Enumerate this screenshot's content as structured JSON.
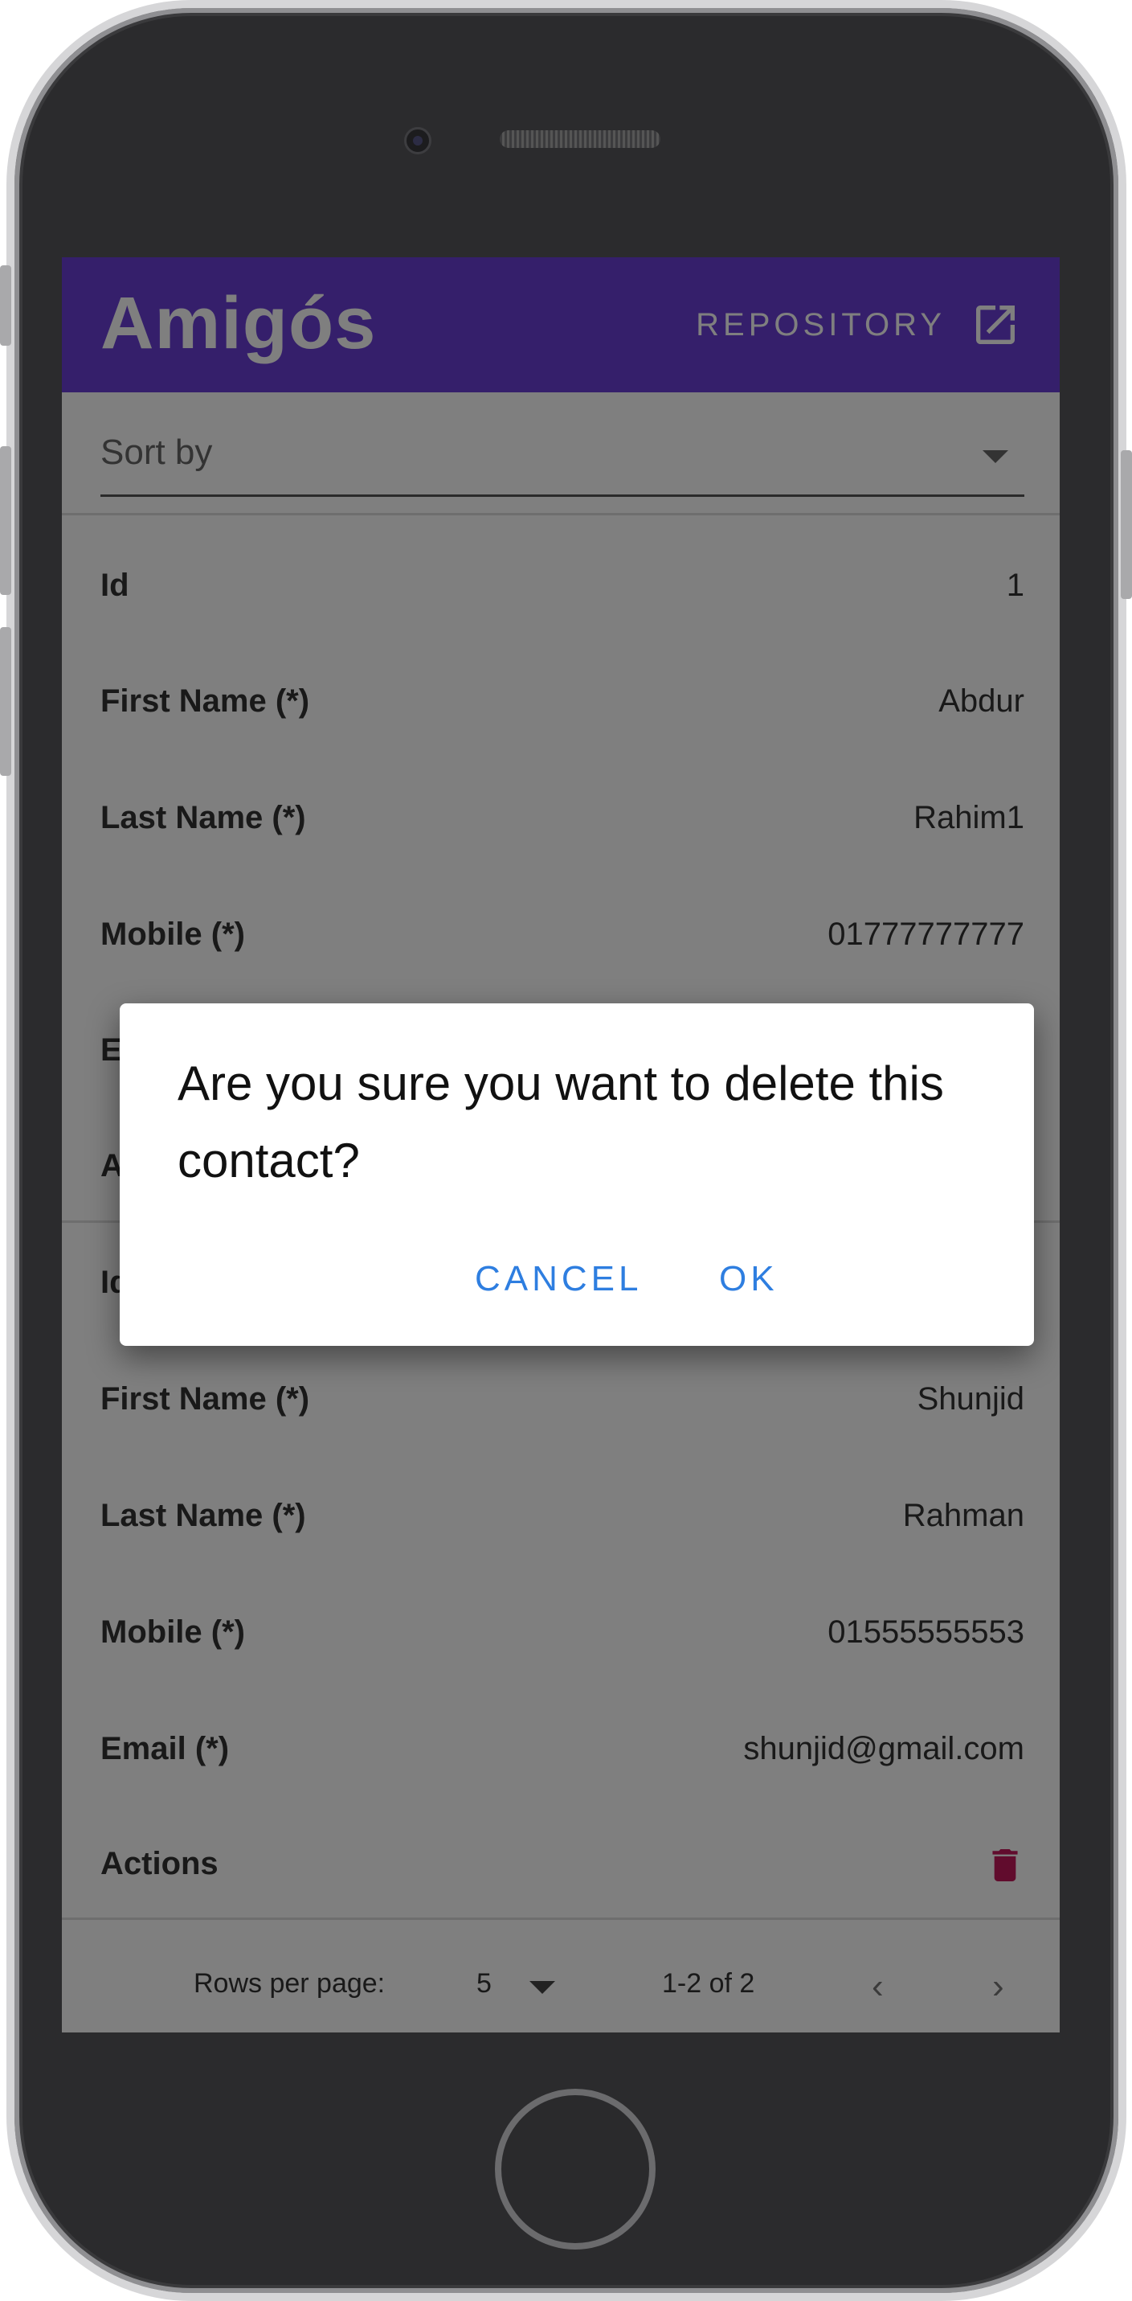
{
  "app": {
    "title": "Amigós",
    "repository_label": "REPOSITORY",
    "repository_icon": "open-in-new-icon",
    "brand_color": "#6a3fd6"
  },
  "sort": {
    "label": "Sort by"
  },
  "contacts": [
    {
      "rows": [
        {
          "label": "Id",
          "value": "1"
        },
        {
          "label": "First Name (*)",
          "value": "Abdur"
        },
        {
          "label": "Last Name (*)",
          "value": "Rahim1"
        },
        {
          "label": "Mobile (*)",
          "value": "01777777777"
        },
        {
          "label": "E",
          "value": ""
        },
        {
          "label": "A",
          "value": ""
        }
      ]
    },
    {
      "rows": [
        {
          "label": "Id",
          "value": ""
        },
        {
          "label": "First Name (*)",
          "value": "Shunjid"
        },
        {
          "label": "Last Name (*)",
          "value": "Rahman"
        },
        {
          "label": "Mobile (*)",
          "value": "01555555553"
        },
        {
          "label": "Email (*)",
          "value": "shunjid@gmail.com"
        },
        {
          "label": "Actions",
          "value": ""
        }
      ]
    }
  ],
  "actions": {
    "delete_icon": "trash-icon",
    "delete_color": "#c2185b"
  },
  "pagination": {
    "rows_per_page_label": "Rows per page:",
    "rows_per_page_value": "5",
    "range": "1-2 of 2",
    "prev_icon": "chevron-left-icon",
    "next_icon": "chevron-right-icon"
  },
  "dialog": {
    "message": "Are you sure you want to delete this contact?",
    "cancel_label": "CANCEL",
    "ok_label": "OK",
    "button_color": "#2e7ee0"
  }
}
